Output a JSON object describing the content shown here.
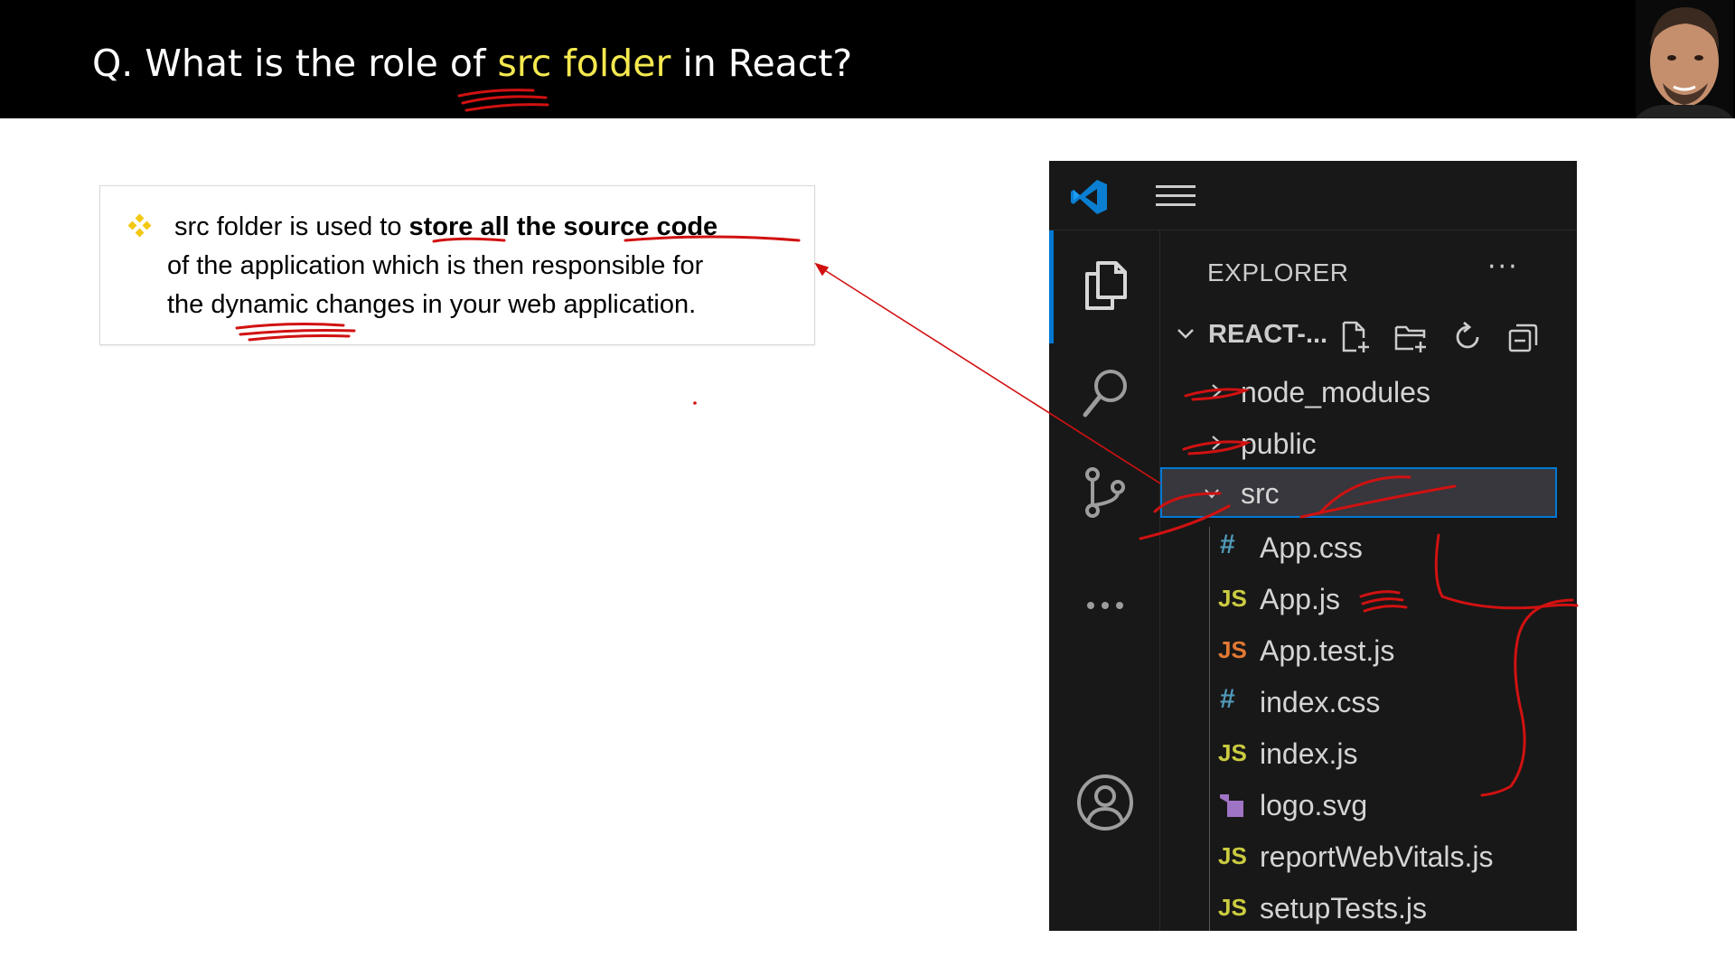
{
  "slide": {
    "title_prefix": "Q. What is the role of ",
    "title_highlight": "src folder",
    "title_suffix": " in React?",
    "highlight_color": "#f5e94f",
    "bullet_color": "#f2c811",
    "bullet": {
      "line1_pre": "src folder is used to ",
      "line1_bold": "store all the source code",
      "line2": "of the application which is then responsible for",
      "line3": "the dynamic changes in your web application."
    }
  },
  "vscode": {
    "accent": "#0078d4",
    "explorer_title": "EXPLORER",
    "explorer_more": "···",
    "folder_name": "REACT-...",
    "toolbar_icons": [
      "new-file-icon",
      "new-folder-icon",
      "refresh-icon",
      "collapse-all-icon"
    ],
    "activity_icons": [
      "files-icon",
      "search-icon",
      "source-control-icon",
      "more-icon",
      "account-icon"
    ],
    "tree": {
      "node_modules": "node_modules",
      "public": "public",
      "src": "src",
      "files": [
        {
          "name": "App.css",
          "icon": "#"
        },
        {
          "name": "App.js",
          "icon": "JS"
        },
        {
          "name": "App.test.js",
          "icon": "JS"
        },
        {
          "name": "index.css",
          "icon": "#"
        },
        {
          "name": "index.js",
          "icon": "JS"
        },
        {
          "name": "logo.svg",
          "icon": "svg-file-icon"
        },
        {
          "name": "reportWebVitals.js",
          "icon": "JS"
        },
        {
          "name": "setupTests.js",
          "icon": "JS"
        }
      ]
    }
  },
  "annotation_color": "#d11111"
}
